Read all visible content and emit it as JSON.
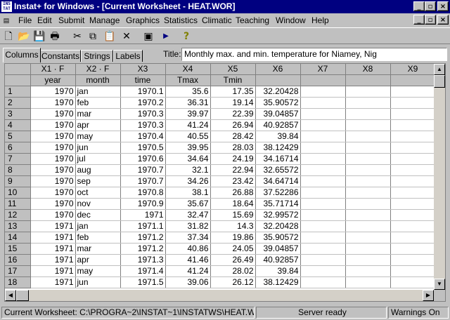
{
  "window": {
    "title": "Instat+ for Windows - [Current Worksheet - HEAT.WOR]",
    "app_icon_text": "INS TAT"
  },
  "menu": [
    "File",
    "Edit",
    "Submit",
    "Manage",
    "Graphics",
    "Statistics",
    "Climatic",
    "Teaching",
    "Window",
    "Help"
  ],
  "toolbar": {
    "icons": [
      "new-file-icon",
      "open-folder-icon",
      "save-icon",
      "print-icon",
      "cut-icon",
      "copy-icon",
      "paste-icon",
      "delete-icon",
      "dialog-icon",
      "play-icon",
      "help-icon"
    ]
  },
  "tabs": [
    "Columns",
    "Constants",
    "Strings",
    "Labels"
  ],
  "active_tab": "Columns",
  "title_field": {
    "label": "Title:",
    "value": "Monthly max. and min. temperature for Niamey, Nig"
  },
  "grid": {
    "columns": [
      "X1 · F",
      "X2 · F",
      "X3",
      "X4",
      "X5",
      "X6",
      "X7",
      "X8",
      "X9"
    ],
    "names": [
      "year",
      "month",
      "time",
      "Tmax",
      "Tmin",
      "",
      "",
      "",
      ""
    ],
    "rows": [
      [
        "1",
        "1970",
        "jan",
        "1970.1",
        "35.6",
        "17.35",
        "32.20428"
      ],
      [
        "2",
        "1970",
        "feb",
        "1970.2",
        "36.31",
        "19.14",
        "35.90572"
      ],
      [
        "3",
        "1970",
        "mar",
        "1970.3",
        "39.97",
        "22.39",
        "39.04857"
      ],
      [
        "4",
        "1970",
        "apr",
        "1970.3",
        "41.24",
        "26.94",
        "40.92857"
      ],
      [
        "5",
        "1970",
        "may",
        "1970.4",
        "40.55",
        "28.42",
        "39.84"
      ],
      [
        "6",
        "1970",
        "jun",
        "1970.5",
        "39.95",
        "28.03",
        "38.12429"
      ],
      [
        "7",
        "1970",
        "jul",
        "1970.6",
        "34.64",
        "24.19",
        "34.16714"
      ],
      [
        "8",
        "1970",
        "aug",
        "1970.7",
        "32.1",
        "22.94",
        "32.65572"
      ],
      [
        "9",
        "1970",
        "sep",
        "1970.7",
        "34.26",
        "23.42",
        "34.64714"
      ],
      [
        "10",
        "1970",
        "oct",
        "1970.8",
        "38.1",
        "26.88",
        "37.52286"
      ],
      [
        "11",
        "1970",
        "nov",
        "1970.9",
        "35.67",
        "18.64",
        "35.71714"
      ],
      [
        "12",
        "1970",
        "dec",
        "1971",
        "32.47",
        "15.69",
        "32.99572"
      ],
      [
        "13",
        "1971",
        "jan",
        "1971.1",
        "31.82",
        "14.3",
        "32.20428"
      ],
      [
        "14",
        "1971",
        "feb",
        "1971.2",
        "37.34",
        "19.86",
        "35.90572"
      ],
      [
        "15",
        "1971",
        "mar",
        "1971.2",
        "40.86",
        "24.05",
        "39.04857"
      ],
      [
        "16",
        "1971",
        "apr",
        "1971.3",
        "41.46",
        "26.49",
        "40.92857"
      ],
      [
        "17",
        "1971",
        "may",
        "1971.4",
        "41.24",
        "28.02",
        "39.84"
      ],
      [
        "18",
        "1971",
        "jun",
        "1971.5",
        "39.06",
        "26.12",
        "38.12429"
      ]
    ]
  },
  "status": {
    "worksheet": "Current Worksheet: C:\\PROGRA~2\\INSTAT~1\\INSTATWS\\HEAT.WOR",
    "server": "Server ready",
    "warnings": "Warnings On"
  },
  "colors": {
    "titlebar": "#000080",
    "face": "#c0c0c0"
  }
}
